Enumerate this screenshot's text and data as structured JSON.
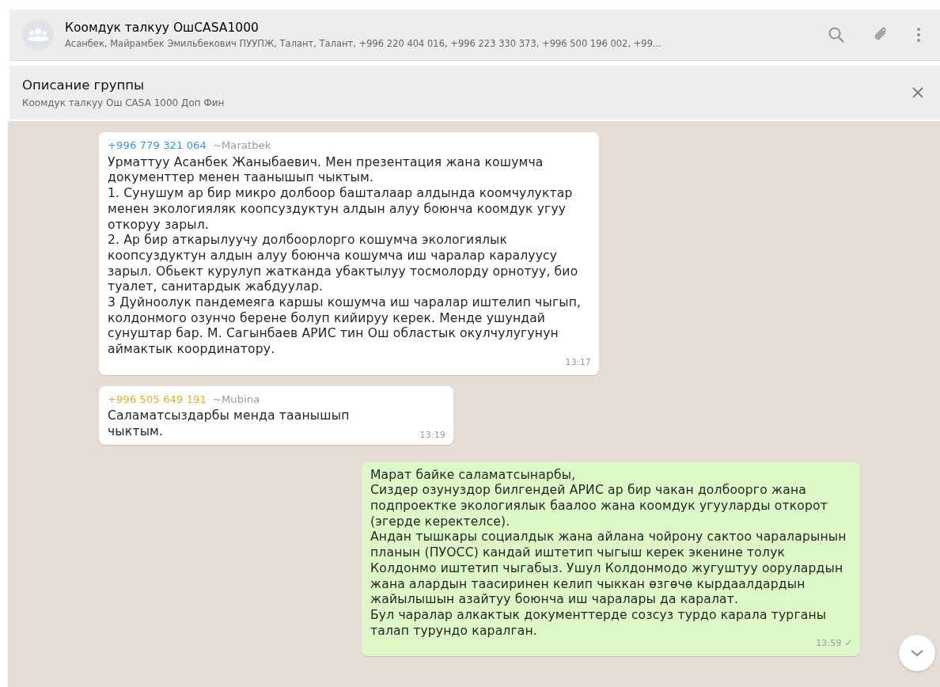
{
  "chat_header": {
    "title": "Коомдук талкуу ОшCASA1000",
    "members": "Асанбек, Майрамбек Эмильбекович ПУУПЖ, Талант, Талант, +996 220 404 016, +996 223 330 373, +996 500 196 002, +99..."
  },
  "group_info": {
    "title": "Описание группы",
    "description": "Коомдук талкуу Ош CASA 1000 Доп Фин"
  },
  "messages": [
    {
      "kind": "incoming",
      "sender": "+996 779 321 064",
      "color": "#3b8ff0",
      "name": "~Maratbek",
      "paragraphs": [
        "Урматтуу Асанбек Жаныбаевич. Мен презентация жана кошумча документтер менен таанышып чыктым.",
        "1. Сунушум ар бир микро долбоор башталаар алдында коомчулуктар менен экологияляк коопсуздуктун алдын алуу боюнча коомдук угуу откоруу зарыл.",
        "2. Ар бир аткарылуучу долбоорлорго кошумча экологиялык коопсуздуктун алдын алуу боюнча кошумча иш чаралар каралуусу зарыл. Обьект курулуп жатканда убактылуу тосмолорду орнотуу, био туалет, санитардык жабдуулар.",
        "3 Дуйноолук пандемеяга каршы кошумча иш чаралар иштелип чыгып, колдонмого озунчо берене болуп кийируу керек. Менде ушундай сунуштар бар. М. Сагынбаев АРИС тин Ош областык окулчулугунун аймактык координатору."
      ],
      "time": "13:17"
    },
    {
      "kind": "incoming",
      "sender": "+996 505 649 191",
      "color": "#e0b12a",
      "name": "~Mubina",
      "paragraphs": [
        "Саламатсыздарбы менда таанышып чыктым."
      ],
      "time": "13:19"
    },
    {
      "kind": "outgoing",
      "paragraphs": [
        "Марат байке саламатсынарбы,",
        "Сиздер озунуздор билгендей АРИС ар бир чакан долбоорго жана подпроектке экологиялык баалоо жана коомдук угууларды откорот (эгерде керектелсе).",
        "Андан тышкары социалдык жана айлана чойрону сактоо чараларынын планын (ПУОСС) кандай иштетип чыгыш керек экенине толук Колдонмо иштетип чыгабыз. Ушул Колдонмодо жугуштуу оорулардын жана алардын таасиринен келип чыккан өзгөчө кырдаалдардын жайылышын азайтуу боюнча иш чаралары да каралат.",
        "Бул чаралар алкактык документтерде созсуз турдо карала турганы талап турундо каралган."
      ],
      "time": "13:59",
      "tick": "✓"
    }
  ]
}
